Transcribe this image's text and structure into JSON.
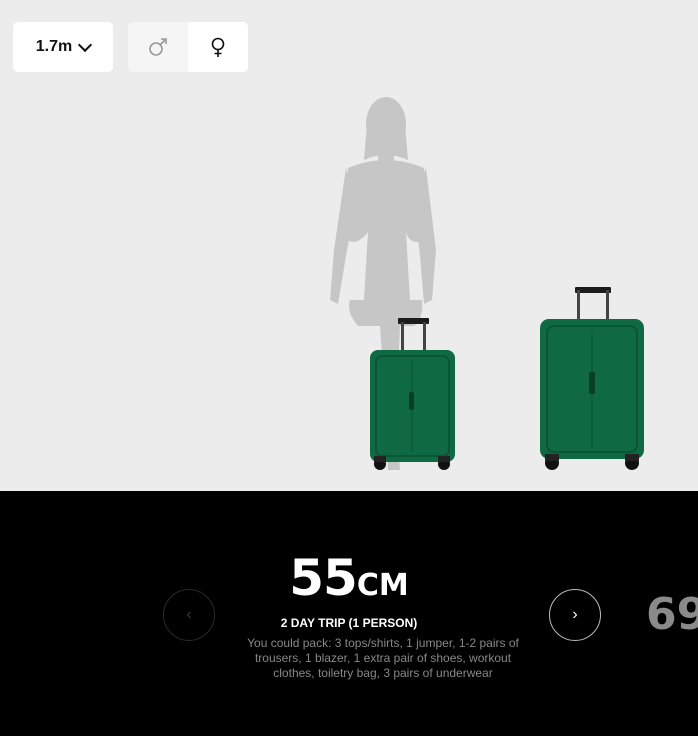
{
  "viewer": {
    "height_select": {
      "value": "1.7m",
      "chevron_icon": "chevron-down-icon"
    },
    "gender_toggle": {
      "male_icon": "male-symbol-icon",
      "female_icon": "female-symbol-icon",
      "selected": "female"
    },
    "colors": {
      "background": "#ececec",
      "silhouette": "#c8c8c8",
      "suitcase_green": "#0f6a44"
    }
  },
  "info": {
    "size_number": "55",
    "size_unit": "CM",
    "trip_title": "2 DAY TRIP (1 PERSON)",
    "pack_text": "You could pack: 3 tops/shirts, 1 jumper, 1-2 pairs of trousers, 1 blazer, 1 extra pair of shoes, workout clothes, toiletry bag, 3 pairs of underwear",
    "prev_icon": "chevron-left-icon",
    "next_icon": "chevron-right-icon",
    "next_size_peek": "69"
  }
}
